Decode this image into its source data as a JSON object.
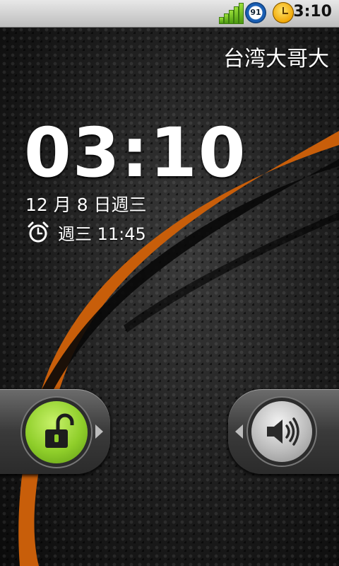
{
  "status_bar": {
    "battery_level": "91",
    "time": "3:10",
    "signal_bars": 5
  },
  "carrier": "台湾大哥大",
  "lock_screen": {
    "time": "03:10",
    "date": "12 月 8 日週三",
    "next_alarm": "週三 11:45"
  },
  "icons": {
    "signal": "signal-strength-icon",
    "battery": "battery-icon",
    "alarm_status": "alarm-status-icon",
    "alarm": "alarm-clock-icon",
    "unlock": "unlock-icon",
    "sound": "sound-on-icon",
    "arrow_right": "chevron-right-icon",
    "arrow_left": "chevron-left-icon"
  },
  "colors": {
    "accent_orange": "#e07010",
    "unlock_green": "#8fce2a",
    "sound_gray": "#bcbcbc"
  }
}
